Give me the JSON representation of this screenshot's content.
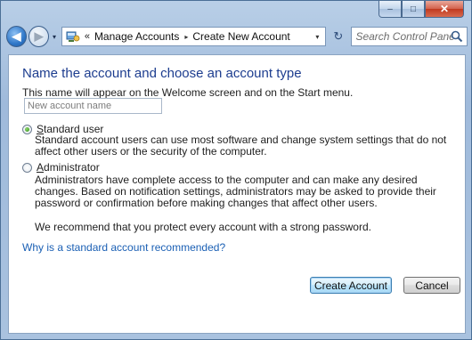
{
  "window": {
    "minimize_glyph": "–",
    "maximize_glyph": "□",
    "close_glyph": "✕"
  },
  "navigation": {
    "back_glyph": "◀",
    "forward_glyph": "▶",
    "recent_glyph": "▾",
    "address": {
      "icon": "control-panel-icon",
      "overflow_chevron": "«",
      "breadcrumbs": [
        "Manage Accounts",
        "Create New Account"
      ],
      "separator_glyph": "▸",
      "dropdown_glyph": "▾"
    },
    "refresh_glyph": "↻",
    "search": {
      "placeholder": "Search Control Panel"
    }
  },
  "main": {
    "heading": "Name the account and choose an account type",
    "subtext": "This name will appear on the Welcome screen and on the Start menu.",
    "name_input": {
      "placeholder": "New account name",
      "value": ""
    },
    "account_types": [
      {
        "label_accel": "S",
        "label_rest": "tandard user",
        "selected": true,
        "description": "Standard account users can use most software and change system settings that do not affect other users or the security of the computer."
      },
      {
        "label_accel": "A",
        "label_rest": "dministrator",
        "selected": false,
        "description": "Administrators have complete access to the computer and can make any desired changes. Based on notification settings, administrators may be asked to provide their password or confirmation before making changes that affect other users."
      }
    ],
    "recommendation": "We recommend that you protect every account with a strong password.",
    "help_link": "Why is a standard account recommended?",
    "buttons": {
      "create": "Create Account",
      "cancel": "Cancel"
    }
  },
  "colors": {
    "heading": "#1d3d8f",
    "link": "#1a5fb4",
    "radio_selected": "#2f8e17"
  }
}
